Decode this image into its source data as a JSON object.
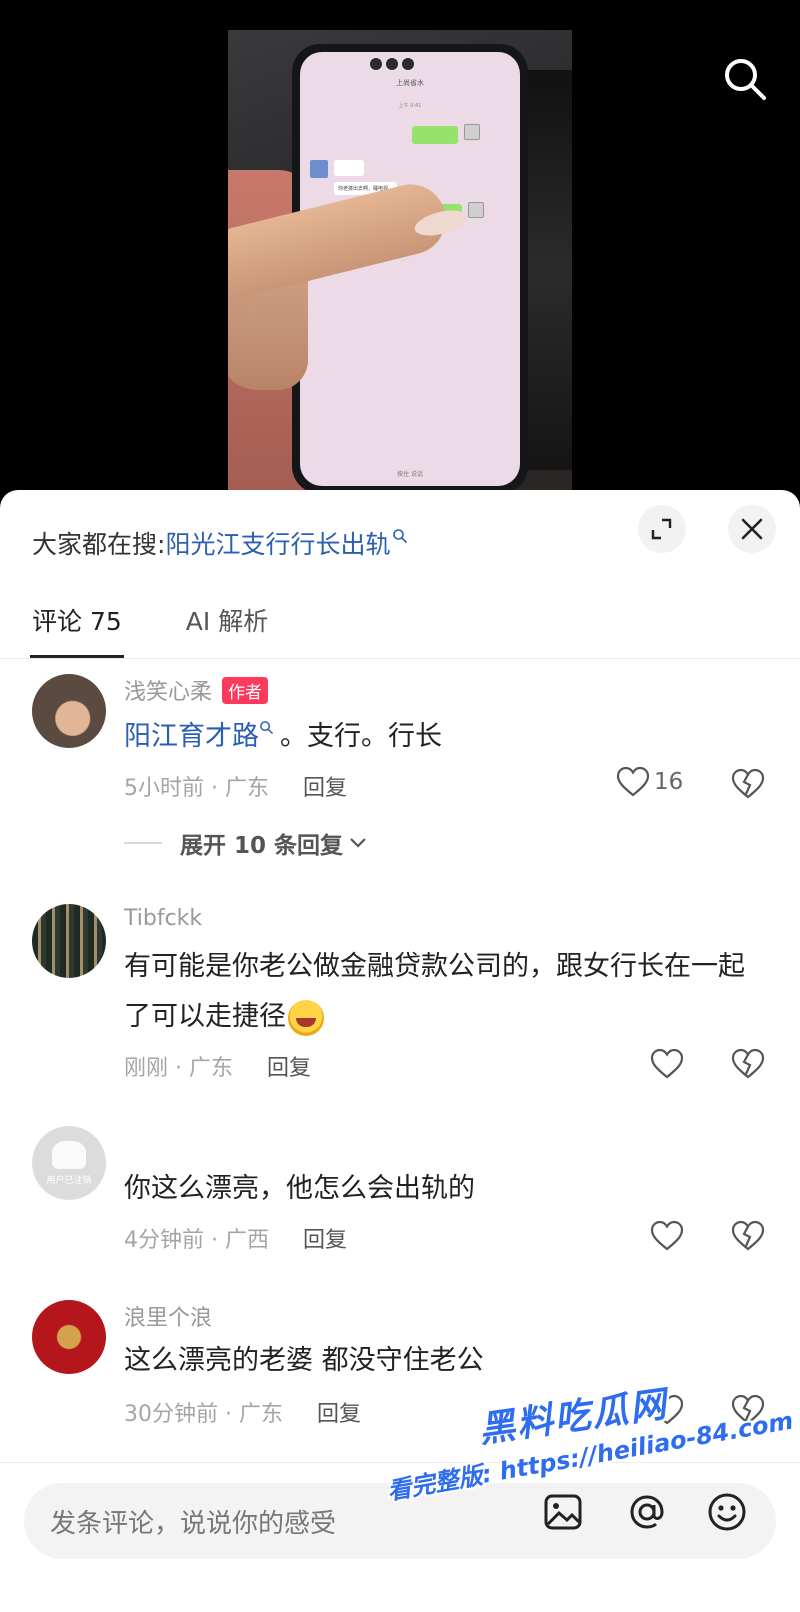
{
  "video": {
    "phone_chat_title": "上尚省水",
    "phone_chat_time": "上午 9:41",
    "phone_message_white": "你老婆出去啊，睡电视。",
    "phone_footer": "按住 说话"
  },
  "search": {
    "prefix": "大家都在搜:",
    "term": "阳光江支行行长出轨"
  },
  "tabs": {
    "comments_label": "评论 75",
    "ai_label": "AI 解析"
  },
  "comments": [
    {
      "username": "浅笑心柔",
      "badge": "作者",
      "text_link": "阳江育才路",
      "text_rest": "。支行。行长",
      "time_location": "5小时前 · 广东",
      "reply_label": "回复",
      "likes": "16",
      "expand_label": "展开 10 条回复"
    },
    {
      "username": "Tibfckk",
      "text": "有可能是你老公做金融贷款公司的，跟女行长在一起了可以走捷径",
      "emoji": "grinning-squinting-tears-emoji",
      "time_location": "刚刚 · 广东",
      "reply_label": "回复"
    },
    {
      "username": "",
      "avatar_text": "用户已注销",
      "text": "你这么漂亮，他怎么会出轨的",
      "time_location": "4分钟前 · 广西",
      "reply_label": "回复"
    },
    {
      "username": "浪里个浪",
      "text": "这么漂亮的老婆   都没守住老公",
      "time_location": "30分钟前 · 广东",
      "reply_label": "回复"
    }
  ],
  "input": {
    "placeholder": "发条评论，说说你的感受"
  },
  "watermark": {
    "title": "黑料吃瓜网",
    "url": "看完整版: https://heiliao-84.com"
  },
  "colors": {
    "link_blue": "#2c5fb3",
    "badge_red": "#fe3a5c",
    "watermark_blue": "#2f6df0"
  },
  "icons": [
    "search-icon",
    "expand-icon",
    "close-icon",
    "heart-icon",
    "broken-heart-icon",
    "chevron-down-icon",
    "image-icon",
    "at-icon",
    "smile-icon",
    "search-link-icon"
  ]
}
